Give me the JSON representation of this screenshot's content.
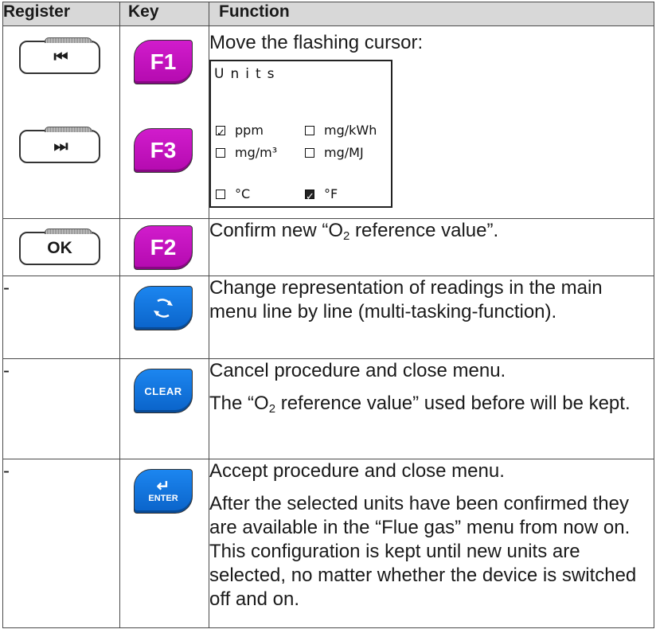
{
  "header": {
    "register": "Register",
    "key": "Key",
    "function": "Function"
  },
  "rows": [
    {
      "function_text": "Move the flashing cursor:",
      "register_icons": [
        "skip-back-icon",
        "skip-forward-icon"
      ],
      "register_glyphs": [
        "⏮",
        "⏭"
      ],
      "keys": [
        "F1",
        "F3"
      ],
      "lcd": {
        "title": "Units",
        "options": [
          {
            "label": "ppm",
            "checked": true
          },
          {
            "label": "mg/kWh",
            "checked": false
          },
          {
            "label": "mg/m³",
            "checked": false
          },
          {
            "label": "mg/MJ",
            "checked": false
          },
          {
            "label": "°C",
            "checked": false
          },
          {
            "label": "°F",
            "checked": true,
            "highlighted": true
          }
        ]
      }
    },
    {
      "register_label": "OK",
      "key": "F2",
      "function_pre": "Confirm new “O",
      "function_sub": "2",
      "function_post": " reference value”."
    },
    {
      "register": "-",
      "key_icon": "refresh-cycle-icon",
      "function_text": "Change representation of readings in the main menu line by line (multi-tasking-function)."
    },
    {
      "register": "-",
      "key": "CLEAR",
      "function_text1": "Cancel procedure and close menu.",
      "function2_pre": "The “O",
      "function2_sub": "2",
      "function2_post": " reference value” used before will be kept."
    },
    {
      "register": "-",
      "key_arrow": "↵",
      "key": "ENTER",
      "function_text1": "Accept procedure and close menu.",
      "function_text2": "After the selected units have been confirmed they are available in the “Flue gas” menu from now on. This configuration is kept until new units are selected, no matter whether the device is switched off and on."
    }
  ],
  "colors": {
    "magenta_key": "#c414be",
    "blue_key": "#137ad8",
    "header_bg": "#d8d8d8"
  }
}
